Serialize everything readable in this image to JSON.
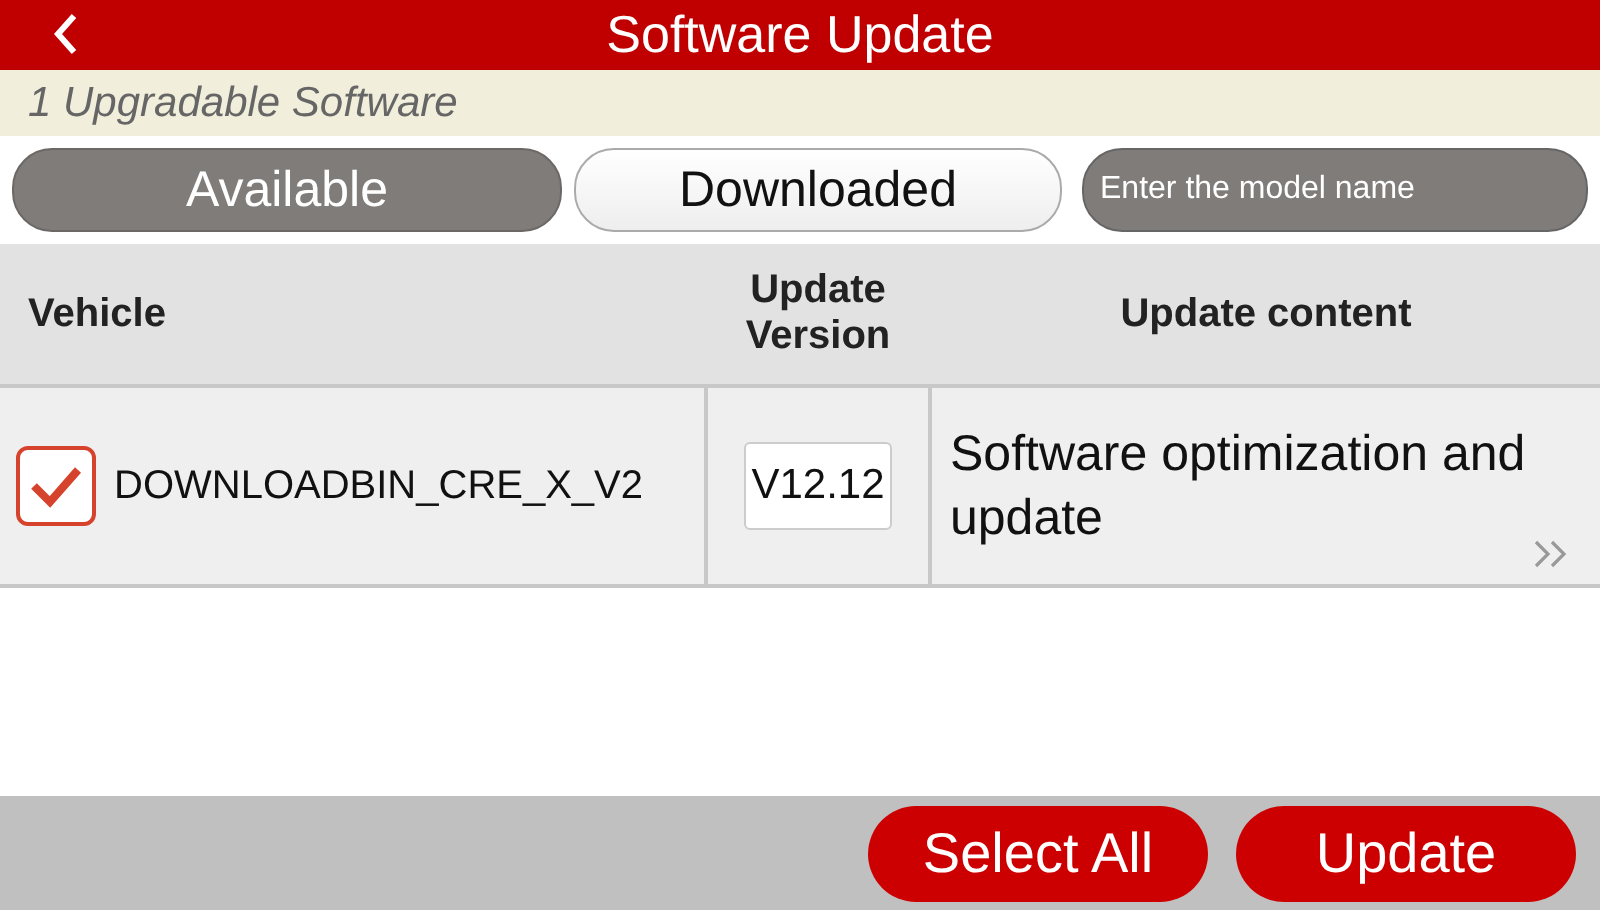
{
  "header": {
    "title": "Software Update"
  },
  "summary": "1 Upgradable Software",
  "tabs": [
    {
      "label": "Available",
      "selected": true
    },
    {
      "label": "Downloaded",
      "selected": false
    }
  ],
  "search": {
    "placeholder": "Enter the model name"
  },
  "table": {
    "columns": [
      "Vehicle",
      "Update Version",
      "Update content"
    ],
    "rows": [
      {
        "checked": true,
        "vehicle": "DOWNLOADBIN_CRE_X_V2",
        "version": "V12.12",
        "content": "Software optimization and update"
      }
    ]
  },
  "buttons": [
    "Select All",
    "Update"
  ]
}
